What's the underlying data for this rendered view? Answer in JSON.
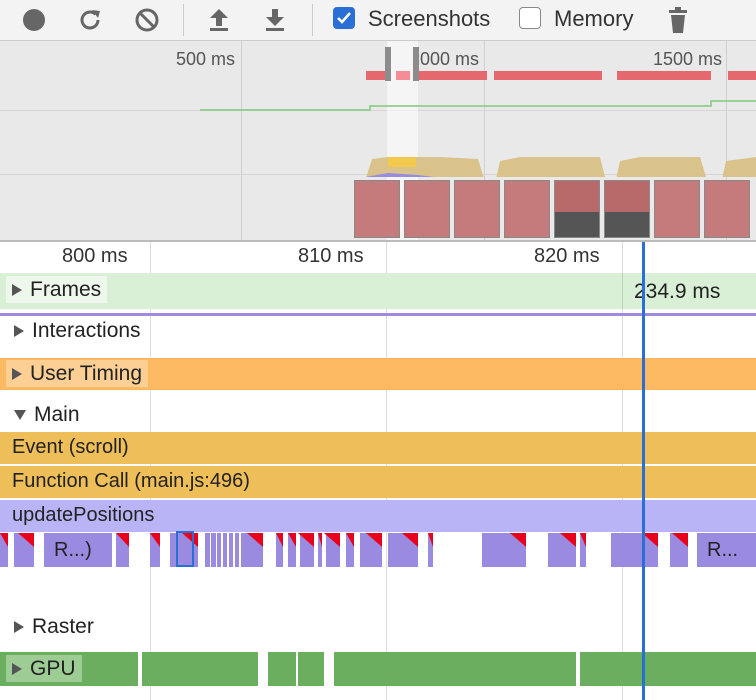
{
  "toolbar": {
    "icons": [
      "record-icon",
      "reload-icon",
      "clear-icon",
      "upload-icon",
      "download-icon",
      "trash-icon"
    ],
    "screenshots_label": "Screenshots",
    "screenshots_checked": true,
    "memory_label": "Memory",
    "memory_checked": false
  },
  "overview": {
    "ticks": [
      "500 ms",
      "000 ms",
      "1500 ms"
    ]
  },
  "timeline": {
    "ruler_ticks": [
      "800 ms",
      "810 ms",
      "820 ms"
    ],
    "frames_label": "Frames",
    "frame_duration": "234.9 ms",
    "interactions_label": "Interactions",
    "user_timing_label": "User Timing",
    "main_label": "Main",
    "flame": {
      "event": "Event (scroll)",
      "function_call": "Function Call (main.js:496)",
      "update_positions": "updatePositions",
      "task_label_1": "R...)",
      "task_label_2": "R..."
    },
    "raster_label": "Raster",
    "gpu_label": "GPU"
  },
  "colors": {
    "accent": "#2a6fd6",
    "frames": "#d9efd6",
    "user_timing": "#fbb962",
    "event": "#eebe58",
    "update_positions": "#b9b4f5",
    "task": "#9b8be0",
    "long_task_flag": "#e8001c",
    "gpu": "#6cae5f"
  }
}
